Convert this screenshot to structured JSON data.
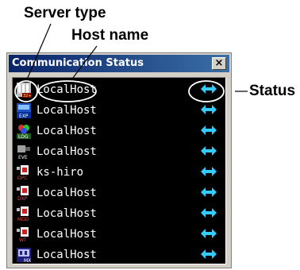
{
  "annotations": {
    "server_type": "Server type",
    "host_name": "Host name",
    "status": "Status"
  },
  "window": {
    "title": "Communication Status",
    "close_glyph": "×"
  },
  "rows": [
    {
      "icon": "server-type-32-icon",
      "host": "LocalHost",
      "status_icon": "bidirectional-arrow-icon"
    },
    {
      "icon": "server-type-exp-icon",
      "host": "LocalHost",
      "status_icon": "bidirectional-arrow-icon"
    },
    {
      "icon": "server-type-log-icon",
      "host": "LocalHost",
      "status_icon": "bidirectional-arrow-icon"
    },
    {
      "icon": "server-type-eve-icon",
      "host": "LocalHost",
      "status_icon": "bidirectional-arrow-icon"
    },
    {
      "icon": "server-type-opc-icon",
      "host": "ks-hiro",
      "status_icon": "bidirectional-arrow-icon"
    },
    {
      "icon": "server-type-dxp-icon",
      "host": "LocalHost",
      "status_icon": "bidirectional-arrow-icon"
    },
    {
      "icon": "server-type-mod-icon",
      "host": "LocalHost",
      "status_icon": "bidirectional-arrow-icon"
    },
    {
      "icon": "server-type-wt-icon",
      "host": "LocalHost",
      "status_icon": "bidirectional-arrow-icon"
    },
    {
      "icon": "server-type-mx-icon",
      "host": "LocalHost",
      "status_icon": "bidirectional-arrow-icon"
    }
  ],
  "colors": {
    "list_background": "#000000",
    "host_text": "#ffffff",
    "status_arrow": "#33ccff",
    "title_bar": "#0a246a"
  }
}
